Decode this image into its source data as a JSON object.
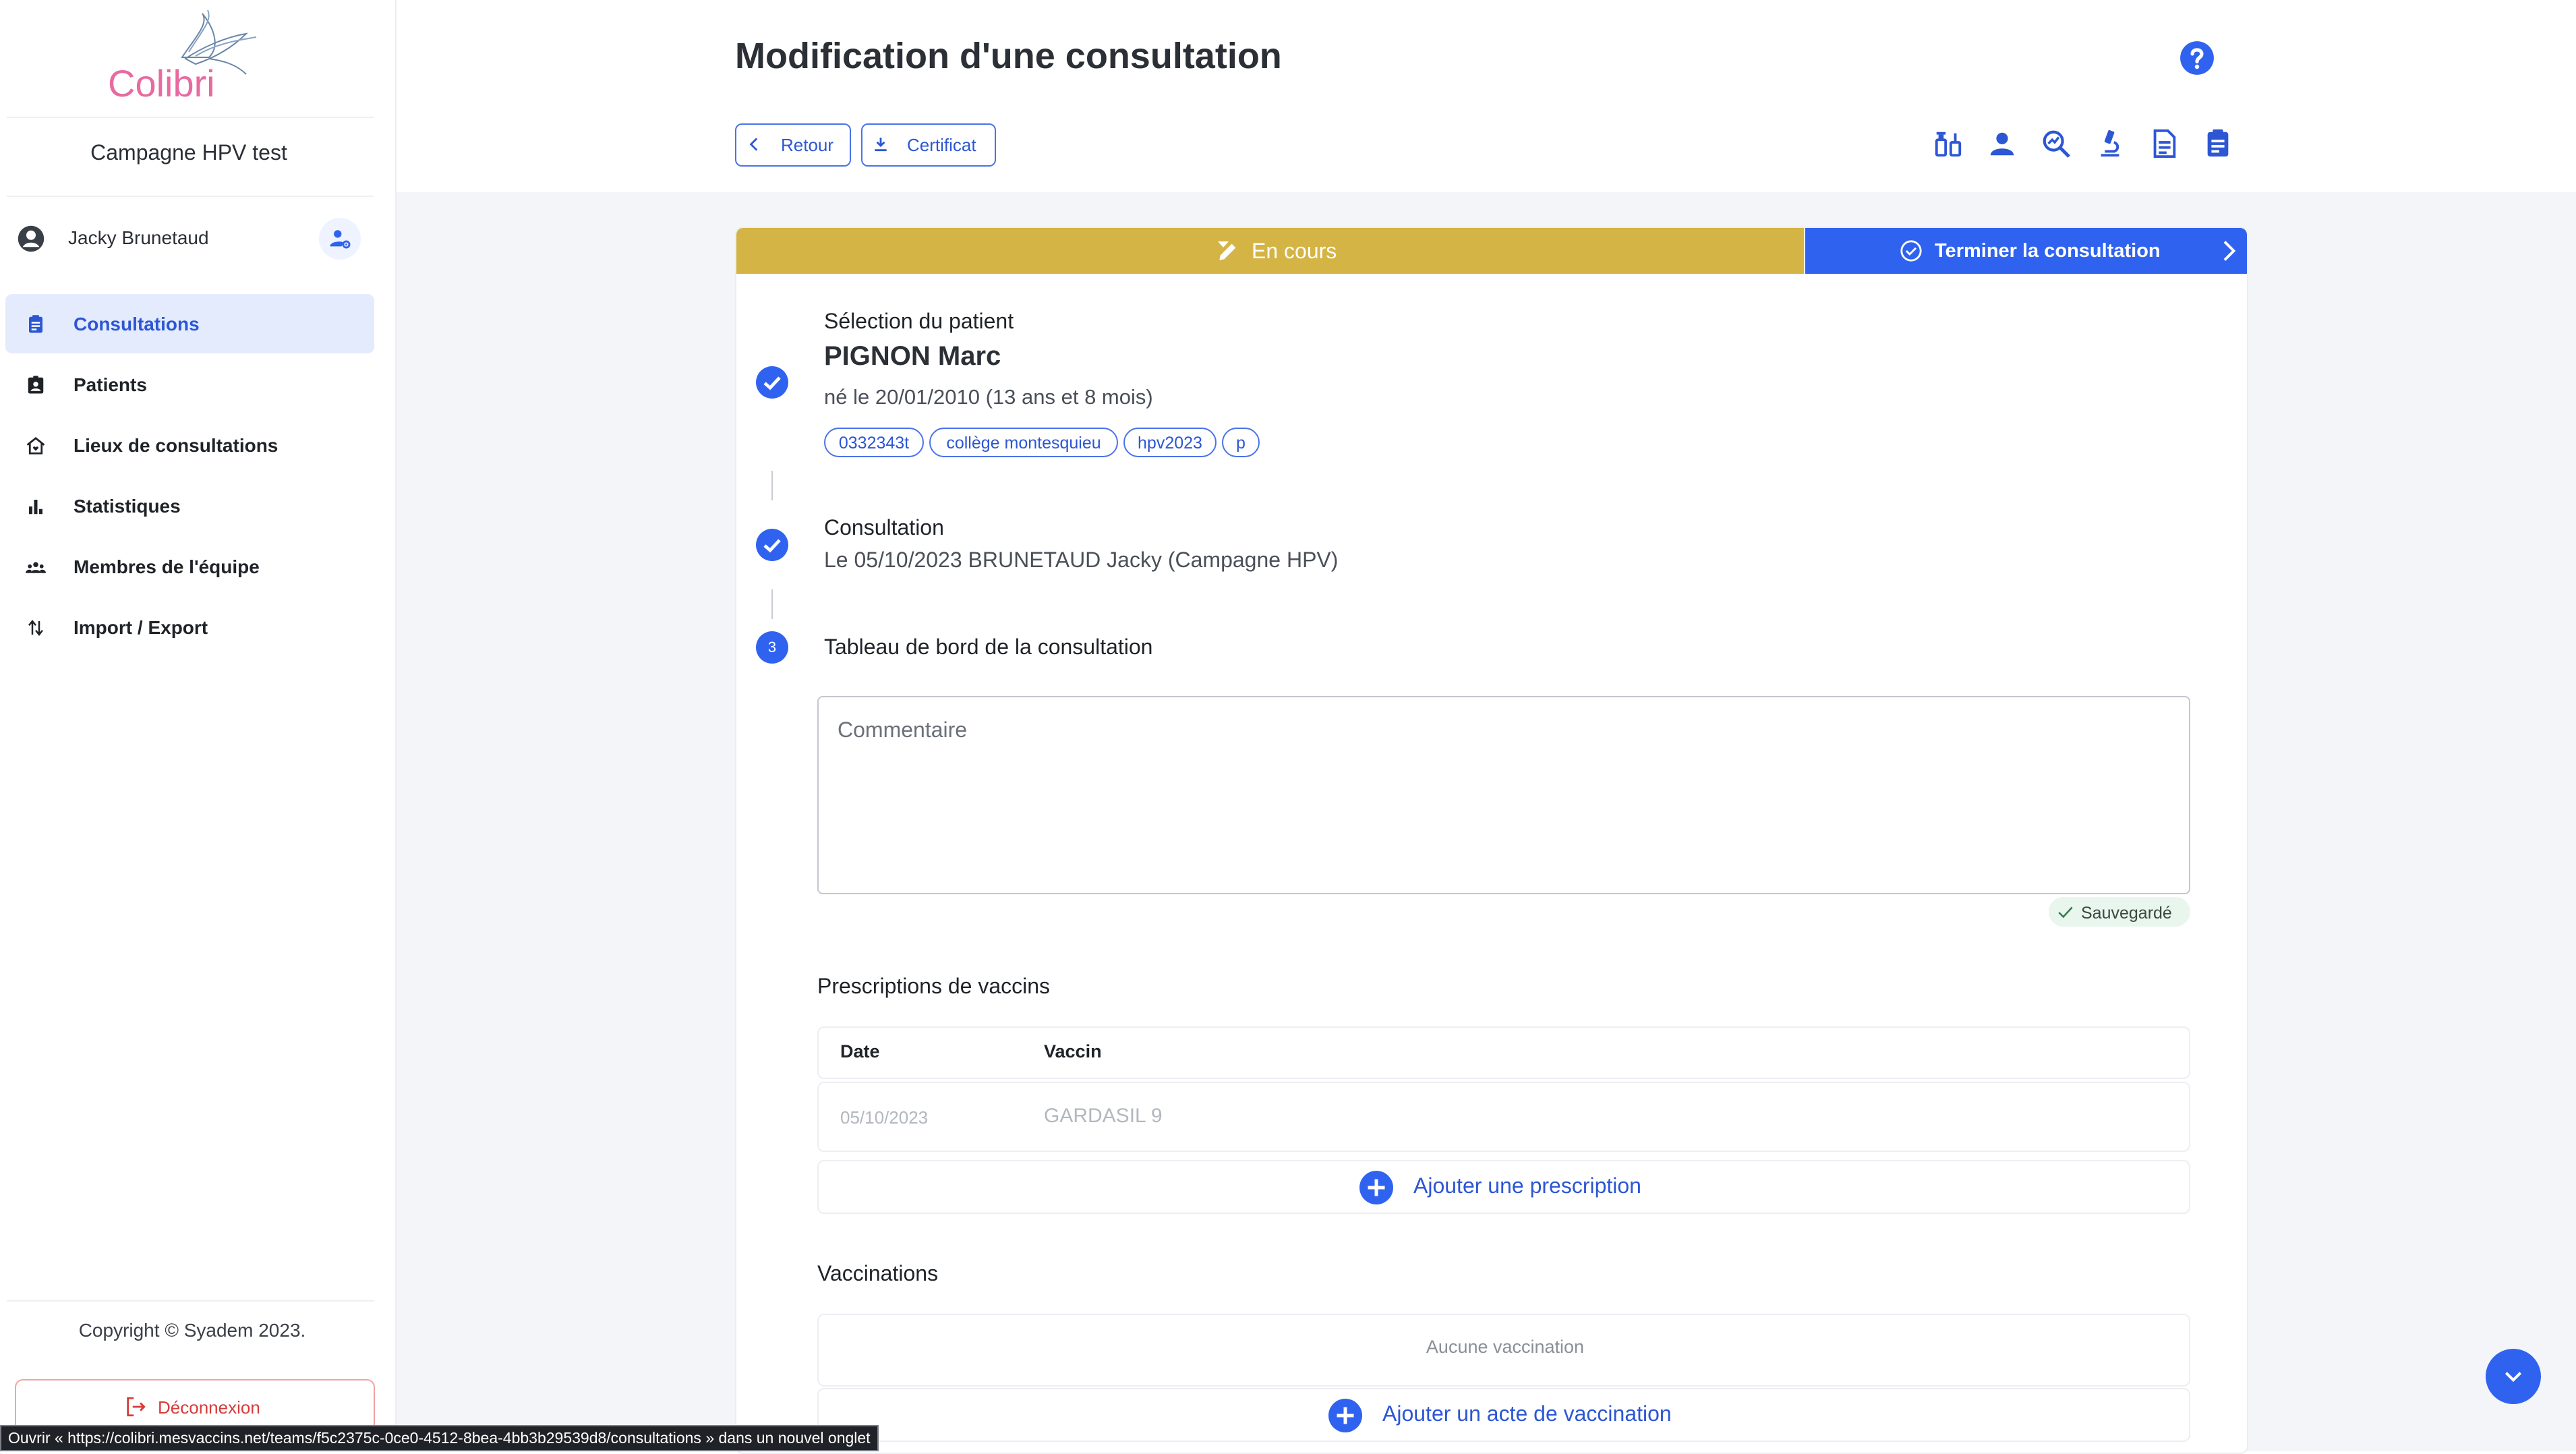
{
  "brand": {
    "name": "Colibri",
    "accent": "#2f63ef",
    "logo_pink": "#e86aa0"
  },
  "sidebar": {
    "campaign": "Campagne HPV test",
    "user_name": "Jacky Brunetaud",
    "items": [
      {
        "label": "Consultations",
        "icon": "clipboard-icon",
        "active": true
      },
      {
        "label": "Patients",
        "icon": "patient-badge-icon",
        "active": false
      },
      {
        "label": "Lieux de consultations",
        "icon": "home-heart-icon",
        "active": false
      },
      {
        "label": "Statistiques",
        "icon": "bar-chart-icon",
        "active": false
      },
      {
        "label": "Membres de l'équipe",
        "icon": "group-icon",
        "active": false
      },
      {
        "label": "Import / Export",
        "icon": "swap-vertical-icon",
        "active": false
      }
    ],
    "copyright": "Copyright © Syadem 2023.",
    "logout_label": "Déconnexion"
  },
  "header": {
    "title": "Modification d'une consultation",
    "back_label": "Retour",
    "certificate_label": "Certificat",
    "tools": [
      "vaccine-icon",
      "person-icon",
      "search-analytics-icon",
      "microscope-icon",
      "document-icon",
      "clipboard-icon"
    ]
  },
  "consultation": {
    "status_label": "En cours",
    "status_color": "#d4b445",
    "finish_label": "Terminer la consultation",
    "steps": {
      "patient_title": "Sélection du patient",
      "patient_name": "PIGNON Marc",
      "patient_birth": "né le 20/01/2010 (13 ans et 8 mois)",
      "tags": [
        "0332343t",
        "collège montesquieu",
        "hpv2023",
        "p"
      ],
      "consult_title": "Consultation",
      "consult_detail": "Le 05/10/2023 BRUNETAUD Jacky (Campagne HPV)",
      "dashboard_number": "3",
      "dashboard_title": "Tableau de bord de la consultation"
    },
    "comment_placeholder": "Commentaire",
    "saved_label": "Sauvegardé",
    "prescriptions": {
      "title": "Prescriptions de vaccins",
      "headers": {
        "date": "Date",
        "vaccine": "Vaccin"
      },
      "rows": [
        {
          "date": "05/10/2023",
          "vaccine": "GARDASIL 9"
        }
      ],
      "add_label": "Ajouter une prescription"
    },
    "vaccinations": {
      "title": "Vaccinations",
      "empty_label": "Aucune vaccination",
      "add_label": "Ajouter un acte de vaccination"
    }
  },
  "status_tooltip": "Ouvrir « https://colibri.mesvaccins.net/teams/f5c2375c-0ce0-4512-8bea-4bb3b29539d8/consultations » dans un nouvel onglet"
}
